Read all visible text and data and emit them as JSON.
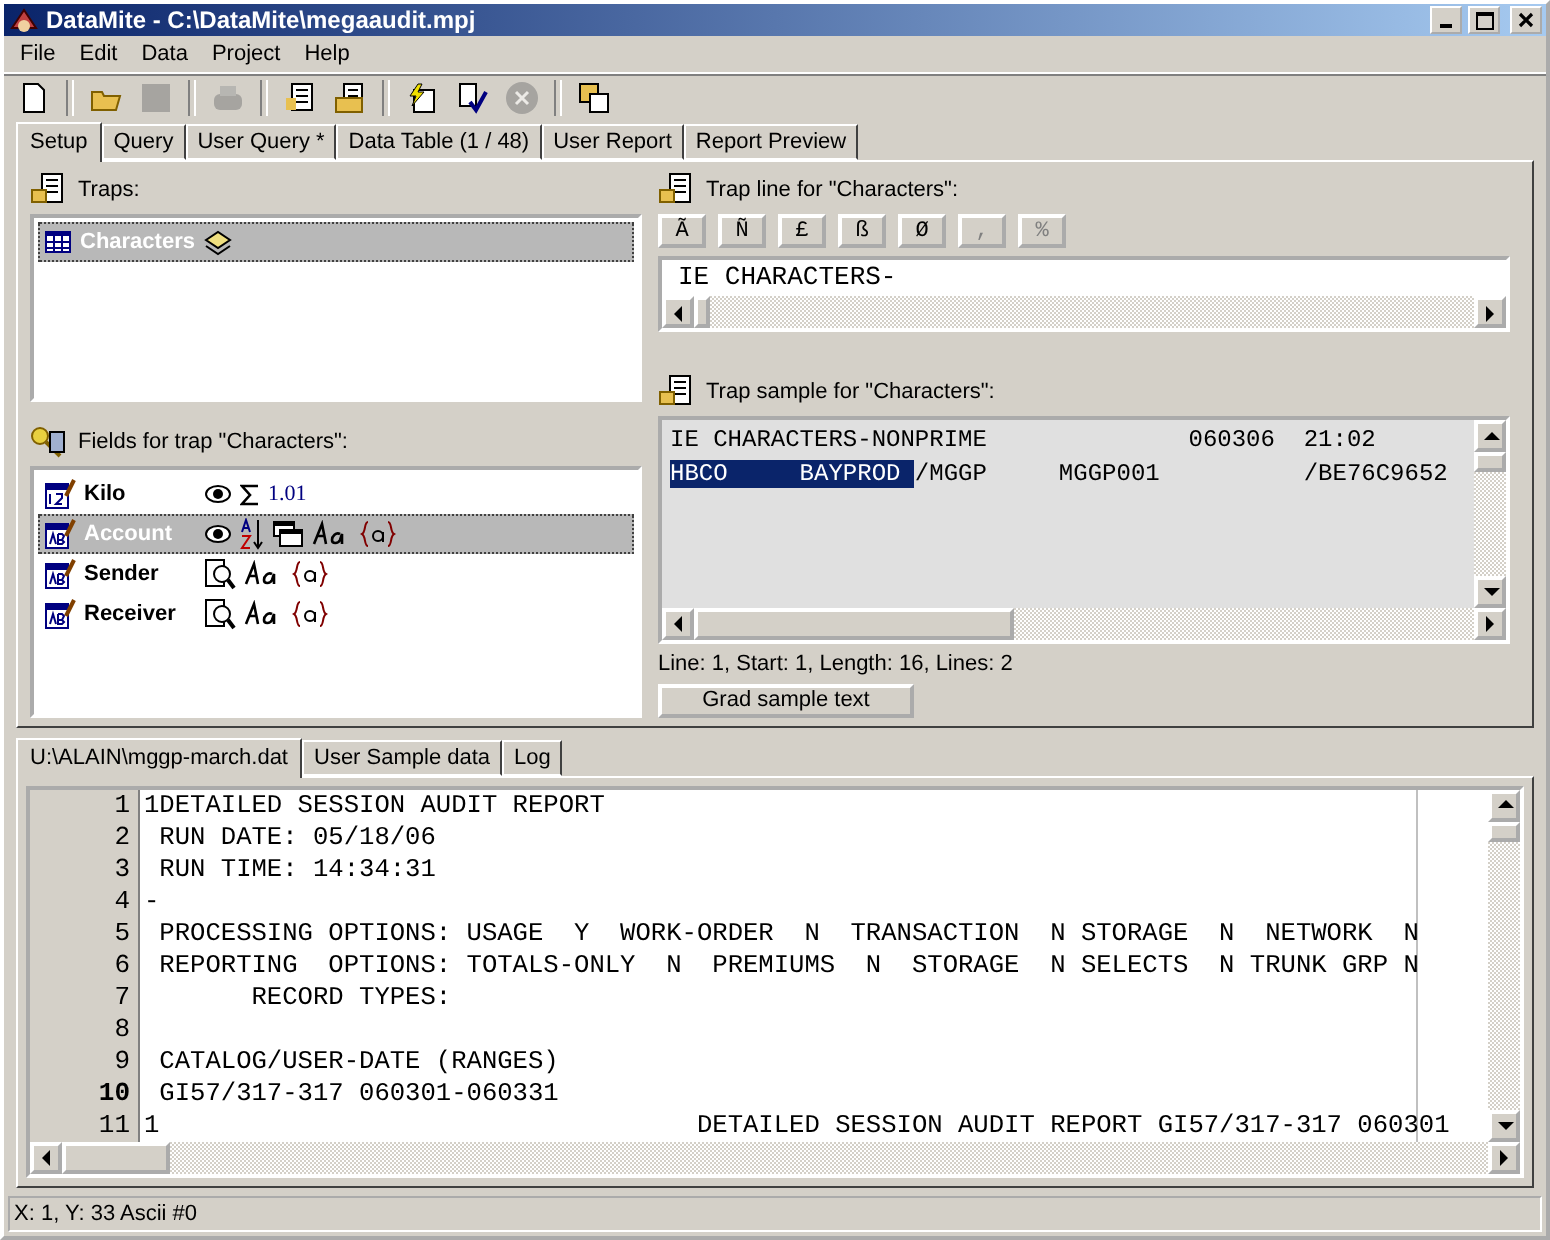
{
  "window": {
    "title": "DataMite - C:\\DataMite\\megaaudit.mpj"
  },
  "menu": [
    "File",
    "Edit",
    "Data",
    "Project",
    "Help"
  ],
  "toolbar": [
    {
      "kind": "new",
      "disabled": false
    },
    {
      "kind": "separator"
    },
    {
      "kind": "open",
      "disabled": false
    },
    {
      "kind": "save",
      "disabled": true
    },
    {
      "kind": "separator"
    },
    {
      "kind": "print",
      "disabled": true
    },
    {
      "kind": "separator"
    },
    {
      "kind": "report",
      "disabled": false
    },
    {
      "kind": "folder-doc",
      "disabled": false
    },
    {
      "kind": "separator"
    },
    {
      "kind": "run",
      "disabled": false
    },
    {
      "kind": "check",
      "disabled": false
    },
    {
      "kind": "cancel",
      "disabled": true
    },
    {
      "kind": "separator"
    },
    {
      "kind": "copy",
      "disabled": false
    }
  ],
  "tabs": [
    {
      "label": "Setup",
      "selected": true
    },
    {
      "label": "Query",
      "selected": false
    },
    {
      "label": "User Query *",
      "selected": false
    },
    {
      "label": "Data Table (1 / 48)",
      "selected": false
    },
    {
      "label": "User Report",
      "selected": false
    },
    {
      "label": "Report Preview",
      "selected": false
    }
  ],
  "traps": {
    "label": "Traps:",
    "items": [
      {
        "name": "Characters",
        "selected": true
      }
    ]
  },
  "fields": {
    "label": "Fields for trap \"Characters\":",
    "items": [
      {
        "name": "Kilo",
        "kind": "numeric",
        "selected": false,
        "options": [
          {
            "kind": "visible"
          },
          {
            "kind": "sum"
          }
        ],
        "format": "1.01"
      },
      {
        "name": "Account",
        "kind": "text",
        "selected": true,
        "options": [
          {
            "kind": "visible"
          },
          {
            "kind": "sort"
          },
          {
            "kind": "group"
          },
          {
            "kind": "case"
          },
          {
            "kind": "mask"
          }
        ]
      },
      {
        "name": "Sender",
        "kind": "text",
        "selected": false,
        "options": [
          {
            "kind": "search"
          },
          {
            "kind": "case"
          },
          {
            "kind": "mask"
          }
        ]
      },
      {
        "name": "Receiver",
        "kind": "text",
        "selected": false,
        "options": [
          {
            "kind": "search"
          },
          {
            "kind": "case"
          },
          {
            "kind": "mask"
          }
        ]
      }
    ]
  },
  "trap_line": {
    "label": "Trap line for \"Characters\":",
    "chars": [
      {
        "char": "Ã",
        "disabled": false
      },
      {
        "char": "Ñ",
        "disabled": false
      },
      {
        "char": "£",
        "disabled": false
      },
      {
        "char": "ß",
        "disabled": false
      },
      {
        "char": "Ø",
        "disabled": false
      },
      {
        "char": ",",
        "disabled": true
      },
      {
        "char": "%",
        "disabled": true
      }
    ],
    "value": "IE CHARACTERS-"
  },
  "trap_sample": {
    "label": "Trap sample for \"Characters\":",
    "lines": [
      [
        {
          "text": "IE CHARACTERS-NONPRIME              060306  21:02",
          "selected": false
        }
      ],
      [
        {
          "text": "HBCO     BAYPROD ",
          "selected": true
        },
        {
          "text": "/MGGP     MGGP001          /BE76C9652",
          "selected": false
        }
      ]
    ],
    "info": "Line: 1, Start: 1, Length: 16, Lines: 2",
    "button": "Grad sample text"
  },
  "bottom_tabs": [
    {
      "label": "U:\\ALAIN\\mggp-march.dat",
      "selected": true
    },
    {
      "label": "User Sample data",
      "selected": false
    },
    {
      "label": "Log",
      "selected": false
    }
  ],
  "editor": {
    "lines": [
      {
        "number": "1",
        "text": "1DETAILED SESSION AUDIT REPORT",
        "current": false
      },
      {
        "number": "2",
        "text": " RUN DATE: 05/18/06",
        "current": false
      },
      {
        "number": "3",
        "text": " RUN TIME: 14:34:31",
        "current": false
      },
      {
        "number": "4",
        "text": "-",
        "current": false
      },
      {
        "number": "5",
        "text": " PROCESSING OPTIONS: USAGE  Y  WORK-ORDER  N  TRANSACTION  N STORAGE  N  NETWORK  N",
        "current": false
      },
      {
        "number": "6",
        "text": " REPORTING  OPTIONS: TOTALS-ONLY  N  PREMIUMS  N  STORAGE  N SELECTS  N TRUNK GRP N",
        "current": false
      },
      {
        "number": "7",
        "text": "       RECORD TYPES:",
        "current": false
      },
      {
        "number": "8",
        "current": false
      },
      {
        "number": "9",
        "text": " CATALOG/USER-DATE (RANGES)",
        "current": false
      },
      {
        "number": "10",
        "text": " GI57/317-317 060301-060331",
        "current": true
      },
      {
        "number": "11",
        "text": "1                                   DETAILED SESSION AUDIT REPORT GI57/317-317 060301",
        "current": false
      }
    ]
  },
  "status_bar": "X: 1, Y: 33  Ascii #0"
}
